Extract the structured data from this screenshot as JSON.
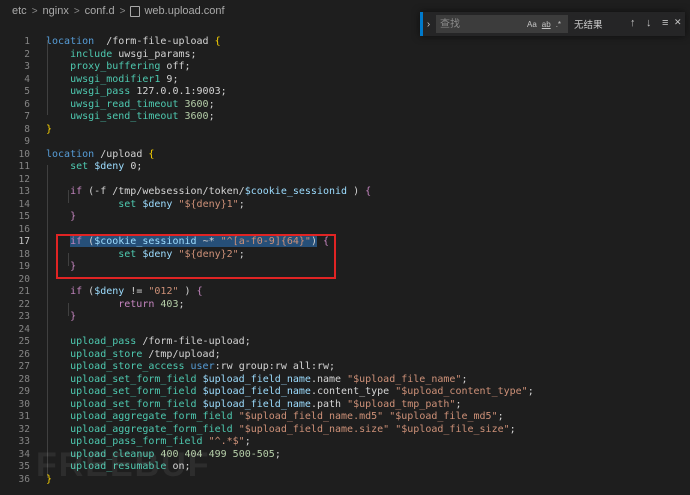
{
  "breadcrumb": {
    "items": [
      "etc",
      "nginx",
      "conf.d",
      "web.upload.conf"
    ]
  },
  "find": {
    "placeholder": "查找",
    "match_case": "Aa",
    "whole_word": "ab",
    "regex": ".*",
    "results": "无结果",
    "prev": "↑",
    "next": "↓",
    "selection": "≡",
    "close": "✕",
    "toggle": "›"
  },
  "editor": {
    "active_line": 17,
    "lines": [
      {
        "n": "1",
        "seg": [
          [
            "kw",
            "location"
          ],
          [
            "",
            "  /form-file-upload "
          ],
          [
            "brace",
            "{"
          ]
        ]
      },
      {
        "n": "2",
        "seg": [
          [
            "",
            "    "
          ],
          [
            "dir",
            "include"
          ],
          [
            "",
            " uwsgi_params;"
          ]
        ]
      },
      {
        "n": "3",
        "seg": [
          [
            "",
            "    "
          ],
          [
            "dir",
            "proxy_buffering"
          ],
          [
            "",
            " off;"
          ]
        ]
      },
      {
        "n": "4",
        "seg": [
          [
            "",
            "    "
          ],
          [
            "dir",
            "uwsgi_modifier1"
          ],
          [
            "",
            " 9;"
          ]
        ]
      },
      {
        "n": "5",
        "seg": [
          [
            "",
            "    "
          ],
          [
            "dir",
            "uwsgi_pass"
          ],
          [
            "",
            " 127.0.0.1:9003;"
          ]
        ]
      },
      {
        "n": "6",
        "seg": [
          [
            "",
            "    "
          ],
          [
            "dir",
            "uwsgi_read_timeout"
          ],
          [
            "",
            " "
          ],
          [
            "num",
            "3600"
          ],
          [
            "",
            ";"
          ]
        ]
      },
      {
        "n": "7",
        "seg": [
          [
            "",
            "    "
          ],
          [
            "dir",
            "uwsgi_send_timeout"
          ],
          [
            "",
            " "
          ],
          [
            "num",
            "3600"
          ],
          [
            "",
            ";"
          ]
        ]
      },
      {
        "n": "8",
        "seg": [
          [
            "brace",
            "}"
          ]
        ]
      },
      {
        "n": "9",
        "seg": []
      },
      {
        "n": "10",
        "seg": [
          [
            "kw",
            "location"
          ],
          [
            "",
            " /upload "
          ],
          [
            "brace",
            "{"
          ]
        ]
      },
      {
        "n": "11",
        "seg": [
          [
            "",
            "    "
          ],
          [
            "dir",
            "set"
          ],
          [
            "",
            " "
          ],
          [
            "var",
            "$deny"
          ],
          [
            "",
            " 0;"
          ]
        ]
      },
      {
        "n": "12",
        "seg": []
      },
      {
        "n": "13",
        "seg": [
          [
            "",
            "    "
          ],
          [
            "ctl",
            "if"
          ],
          [
            "",
            " (-f /tmp/websession/token/"
          ],
          [
            "var",
            "$cookie_sessionid"
          ],
          [
            "",
            " ) "
          ],
          [
            "ctl",
            "{"
          ]
        ]
      },
      {
        "n": "14",
        "seg": [
          [
            "",
            "            "
          ],
          [
            "dir",
            "set"
          ],
          [
            "",
            " "
          ],
          [
            "var",
            "$deny"
          ],
          [
            "",
            " "
          ],
          [
            "str",
            "\"${deny}1\""
          ],
          [
            "",
            ";"
          ]
        ]
      },
      {
        "n": "15",
        "seg": [
          [
            "",
            "    "
          ],
          [
            "ctl",
            "}"
          ]
        ]
      },
      {
        "n": "16",
        "seg": []
      },
      {
        "n": "17",
        "seg": [
          [
            "",
            "    "
          ],
          [
            "sel ctl",
            "if"
          ],
          [
            "sel",
            " ("
          ],
          [
            "sel var",
            "$cookie_sessionid"
          ],
          [
            "sel",
            " ~* "
          ],
          [
            "sel str",
            "\"^[a-f0-9]{64}\""
          ],
          [
            "sel",
            ")"
          ],
          [
            "",
            " "
          ],
          [
            "ctl",
            "{"
          ]
        ]
      },
      {
        "n": "18",
        "seg": [
          [
            "",
            "            "
          ],
          [
            "dir",
            "set"
          ],
          [
            "",
            " "
          ],
          [
            "var",
            "$deny"
          ],
          [
            "",
            " "
          ],
          [
            "str",
            "\"${deny}2\""
          ],
          [
            "",
            ";"
          ]
        ]
      },
      {
        "n": "19",
        "seg": [
          [
            "",
            "    "
          ],
          [
            "ctl",
            "}"
          ]
        ]
      },
      {
        "n": "20",
        "seg": []
      },
      {
        "n": "21",
        "seg": [
          [
            "",
            "    "
          ],
          [
            "ctl",
            "if"
          ],
          [
            "",
            " ("
          ],
          [
            "var",
            "$deny"
          ],
          [
            "",
            " != "
          ],
          [
            "str",
            "\"012\""
          ],
          [
            "",
            " ) "
          ],
          [
            "ctl",
            "{"
          ]
        ]
      },
      {
        "n": "22",
        "seg": [
          [
            "",
            "            "
          ],
          [
            "ctl",
            "return"
          ],
          [
            "",
            " "
          ],
          [
            "num",
            "403"
          ],
          [
            "",
            ";"
          ]
        ]
      },
      {
        "n": "23",
        "seg": [
          [
            "",
            "    "
          ],
          [
            "ctl",
            "}"
          ]
        ]
      },
      {
        "n": "24",
        "seg": []
      },
      {
        "n": "25",
        "seg": [
          [
            "",
            "    "
          ],
          [
            "dir",
            "upload_pass"
          ],
          [
            "",
            " /form-file-upload;"
          ]
        ]
      },
      {
        "n": "26",
        "seg": [
          [
            "",
            "    "
          ],
          [
            "dir",
            "upload_store"
          ],
          [
            "",
            " /tmp/upload;"
          ]
        ]
      },
      {
        "n": "27",
        "seg": [
          [
            "",
            "    "
          ],
          [
            "dir",
            "upload_store_access"
          ],
          [
            "",
            " "
          ],
          [
            "kw",
            "user"
          ],
          [
            "",
            ":rw group:rw all:rw;"
          ]
        ]
      },
      {
        "n": "28",
        "seg": [
          [
            "",
            "    "
          ],
          [
            "dir",
            "upload_set_form_field"
          ],
          [
            "",
            " "
          ],
          [
            "var",
            "$upload_field_name"
          ],
          [
            "",
            ".name "
          ],
          [
            "str",
            "\"$upload_file_name\""
          ],
          [
            "",
            ";"
          ]
        ]
      },
      {
        "n": "29",
        "seg": [
          [
            "",
            "    "
          ],
          [
            "dir",
            "upload_set_form_field"
          ],
          [
            "",
            " "
          ],
          [
            "var",
            "$upload_field_name"
          ],
          [
            "",
            ".content_type "
          ],
          [
            "str",
            "\"$upload_content_type\""
          ],
          [
            "",
            ";"
          ]
        ]
      },
      {
        "n": "30",
        "seg": [
          [
            "",
            "    "
          ],
          [
            "dir",
            "upload_set_form_field"
          ],
          [
            "",
            " "
          ],
          [
            "var",
            "$upload_field_name"
          ],
          [
            "",
            ".path "
          ],
          [
            "str",
            "\"$upload_tmp_path\""
          ],
          [
            "",
            ";"
          ]
        ]
      },
      {
        "n": "31",
        "seg": [
          [
            "",
            "    "
          ],
          [
            "dir",
            "upload_aggregate_form_field"
          ],
          [
            "",
            " "
          ],
          [
            "str",
            "\"$upload_field_name.md5\""
          ],
          [
            "",
            " "
          ],
          [
            "str",
            "\"$upload_file_md5\""
          ],
          [
            "",
            ";"
          ]
        ]
      },
      {
        "n": "32",
        "seg": [
          [
            "",
            "    "
          ],
          [
            "dir",
            "upload_aggregate_form_field"
          ],
          [
            "",
            " "
          ],
          [
            "str",
            "\"$upload_field_name.size\""
          ],
          [
            "",
            " "
          ],
          [
            "str",
            "\"$upload_file_size\""
          ],
          [
            "",
            ";"
          ]
        ]
      },
      {
        "n": "33",
        "seg": [
          [
            "",
            "    "
          ],
          [
            "dir",
            "upload_pass_form_field"
          ],
          [
            "",
            " "
          ],
          [
            "str",
            "\"^.*$\""
          ],
          [
            "",
            ";"
          ]
        ]
      },
      {
        "n": "34",
        "seg": [
          [
            "",
            "    "
          ],
          [
            "dir",
            "upload_cleanup"
          ],
          [
            "",
            " "
          ],
          [
            "num",
            "400 404 499 500-505"
          ],
          [
            "",
            ";"
          ]
        ]
      },
      {
        "n": "35",
        "seg": [
          [
            "",
            "    "
          ],
          [
            "dir",
            "upload_resumable"
          ],
          [
            "",
            " on;"
          ]
        ]
      },
      {
        "n": "36",
        "seg": [
          [
            "brace",
            "}"
          ]
        ]
      }
    ]
  },
  "watermark": "FREEBUF"
}
